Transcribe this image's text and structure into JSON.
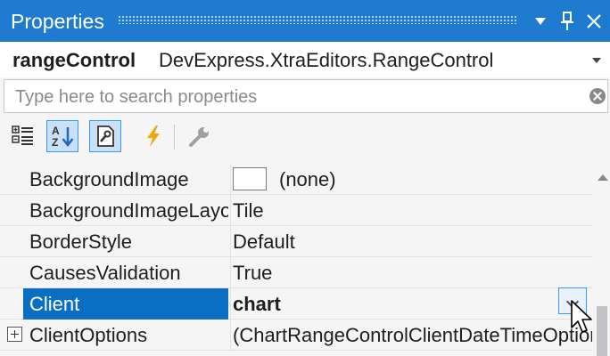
{
  "window": {
    "title": "Properties"
  },
  "object": {
    "name": "rangeControl",
    "type": "DevExpress.XtraEditors.RangeControl"
  },
  "search": {
    "placeholder": "Type here to search properties",
    "value": ""
  },
  "toolbar": {
    "buttons": [
      {
        "icon": "categorized-icon",
        "checked": false
      },
      {
        "icon": "alphabetical-sort-icon",
        "checked": true
      },
      {
        "icon": "properties-page-icon",
        "checked": true
      },
      {
        "icon": "events-lightning-icon",
        "checked": false
      },
      {
        "icon": "wrench-icon",
        "checked": false
      }
    ]
  },
  "properties": [
    {
      "name": "BackgroundImage",
      "value": "(none)",
      "swatch": true,
      "selected": false,
      "expandable": false
    },
    {
      "name": "BackgroundImageLayout",
      "value": "Tile",
      "selected": false,
      "expandable": false
    },
    {
      "name": "BorderStyle",
      "value": "Default",
      "selected": false,
      "expandable": false
    },
    {
      "name": "CausesValidation",
      "value": "True",
      "selected": false,
      "expandable": false
    },
    {
      "name": "Client",
      "value": "chart",
      "selected": true,
      "expandable": false,
      "dropdown": true
    },
    {
      "name": "ClientOptions",
      "value": "(ChartRangeControlClientDateTimeOptions)",
      "selected": false,
      "expandable": true
    }
  ],
  "colors": {
    "accent": "#1e7bd0",
    "selection": "#0a6fc2"
  }
}
